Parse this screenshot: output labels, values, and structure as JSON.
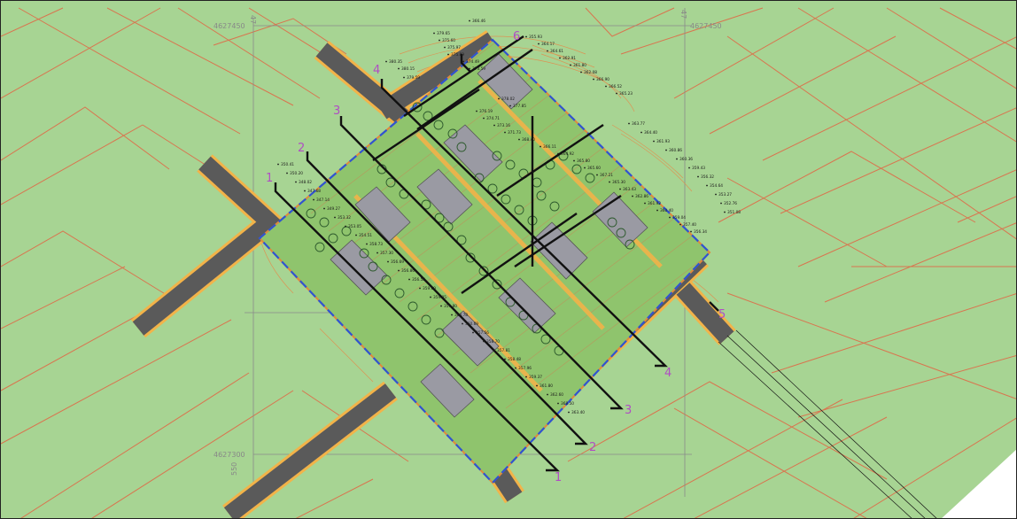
{
  "map": {
    "grid_labels": {
      "north_top_left": "4627450",
      "north_top_right": "4627450",
      "north_bottom_left": "4627300",
      "east_top_left": "47",
      "east_top_right": "47",
      "east_bottom_left": "550"
    },
    "section_markers": [
      "1",
      "2",
      "3",
      "4",
      "5",
      "6"
    ],
    "elevation_labels": [
      "366.46",
      "379.65",
      "375.60",
      "375.97",
      "375.89",
      "374.49",
      "373.59",
      "380.35",
      "380.15",
      "379.59",
      "378.02",
      "377.85",
      "376.19",
      "374.71",
      "373.16",
      "371.73",
      "368.40",
      "366.11",
      "364.92",
      "365.80",
      "365.60",
      "367.21",
      "365.30",
      "363.43",
      "362.86",
      "361.92",
      "360.40",
      "359.04",
      "357.40",
      "356.34",
      "355.93",
      "364.17",
      "364.61",
      "362.91",
      "361.80",
      "362.08",
      "366.90",
      "366.52",
      "365.23",
      "363.77",
      "364.40",
      "361.93",
      "360.86",
      "360.36",
      "359.43",
      "356.32",
      "354.64",
      "353.27",
      "352.76",
      "351.08",
      "350.41",
      "350.20",
      "348.02",
      "347.68",
      "347.14",
      "349.27",
      "353.32",
      "353.05",
      "354.51",
      "358.73",
      "357.30",
      "356.69",
      "356.86",
      "356.58",
      "359.89",
      "359.95",
      "359.80",
      "360.78",
      "360.69",
      "357.56",
      "358.70",
      "357.81",
      "358.48",
      "357.96",
      "359.37",
      "361.80",
      "362.60",
      "368.50",
      "363.40"
    ],
    "colors": {
      "background": "#a7d493",
      "parcel_lines": "#d9754f",
      "site_fill": "#8fc46d",
      "road": "#5a5a5a",
      "road_edge": "#f2b349",
      "building": "#9a9aa3",
      "boundary": "#2f54d1",
      "section_marker": "#b04dc4",
      "cut_lines": "#111111",
      "gridline": "#8a8a8a",
      "contour": "#e58a4a"
    }
  }
}
